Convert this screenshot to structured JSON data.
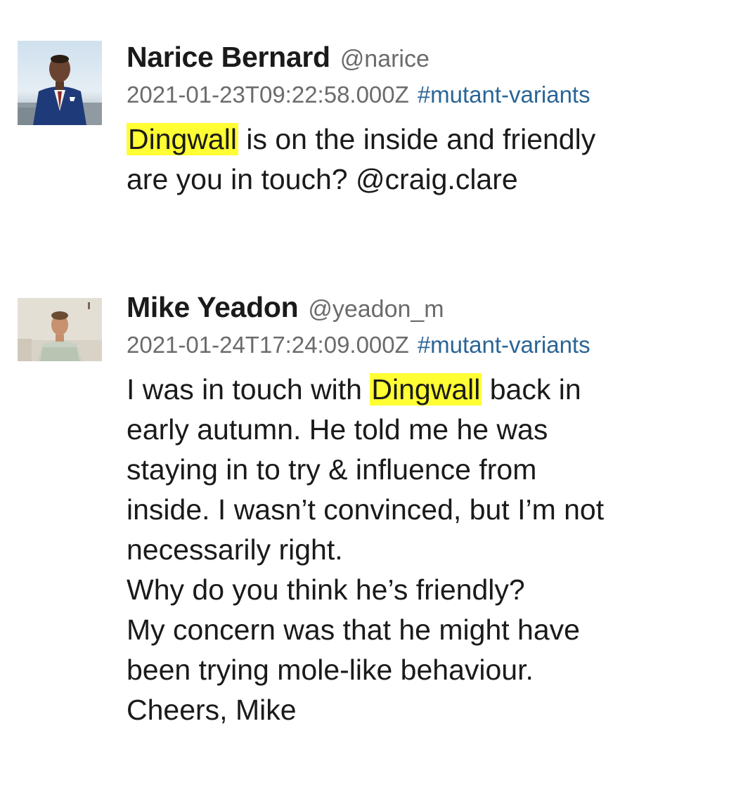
{
  "messages": [
    {
      "author": "Narice Bernard",
      "handle": "@narice",
      "timestamp": "2021-01-23T09:22:58.000Z",
      "channel": "#mutant-variants",
      "lines": [
        {
          "highlight": "Dingwall",
          "before": "",
          "after": " is on the inside and friendly"
        },
        {
          "text": "are you in touch? @craig.clare"
        }
      ]
    },
    {
      "author": "Mike Yeadon",
      "handle": "@yeadon_m",
      "timestamp": "2021-01-24T17:24:09.000Z",
      "channel": "#mutant-variants",
      "lines": [
        {
          "highlight": "Dingwall",
          "before": "I was in touch with ",
          "after": " back in"
        },
        {
          "text": "early autumn. He told me he was"
        },
        {
          "text": "staying in to try & influence from"
        },
        {
          "text": "inside. I wasn’t convinced, but I’m not"
        },
        {
          "text": "necessarily right."
        },
        {
          "text": "Why do you think he’s friendly?"
        },
        {
          "text": "My concern was that he might have"
        },
        {
          "text": "been trying mole-like behaviour."
        },
        {
          "text": "Cheers, Mike"
        }
      ]
    }
  ],
  "colors": {
    "highlight": "#ffff33",
    "channel_link": "#2a6496",
    "meta_text": "#6b6b6b"
  }
}
